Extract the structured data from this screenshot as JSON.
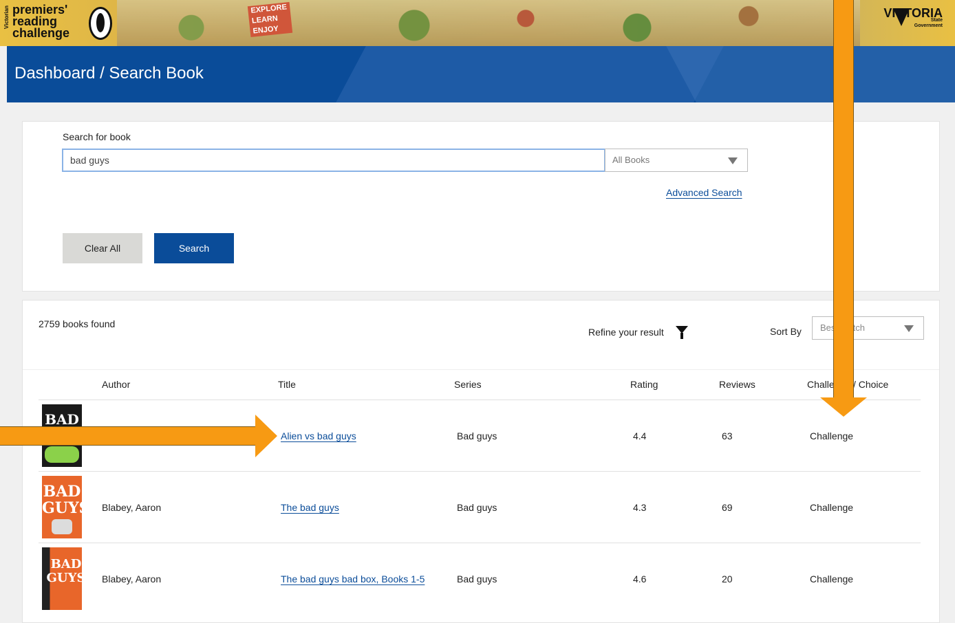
{
  "banner": {
    "logo_lines": [
      "premiers'",
      "reading",
      "challenge"
    ],
    "logo_side": "Victorian",
    "explore_lines": [
      "EXPLORE",
      "LEARN",
      "ENJOY"
    ],
    "victoria": "VICTORIA",
    "victoria_sub": [
      "State",
      "Government"
    ]
  },
  "header": {
    "title": "Dashboard / Search Book"
  },
  "search": {
    "label": "Search for book",
    "query": "bad guys",
    "scope_selected": "All Books",
    "advanced_label": "Advanced Search",
    "clear_label": "Clear All",
    "search_label": "Search"
  },
  "results": {
    "count_text": "2759 books found",
    "refine_label": "Refine your result",
    "sort_label": "Sort By",
    "sort_selected": "Best Match",
    "columns": [
      "Author",
      "Title",
      "Series",
      "Rating",
      "Reviews",
      "Challenge / Choice"
    ],
    "rows": [
      {
        "author": "",
        "title": "Alien vs bad guys",
        "series": "Bad guys",
        "rating": "4.4",
        "reviews": "63",
        "type": "Challenge",
        "cover_color": "#1a1a1a"
      },
      {
        "author": "Blabey, Aaron",
        "title": "The bad guys",
        "series": "Bad guys",
        "rating": "4.3",
        "reviews": "69",
        "type": "Challenge",
        "cover_color": "#e8662a"
      },
      {
        "author": "Blabey, Aaron",
        "title": "The bad guys bad box, Books 1-5",
        "series": "Bad guys",
        "rating": "4.6",
        "reviews": "20",
        "type": "Challenge",
        "cover_color": "#e8662a"
      }
    ]
  },
  "colors": {
    "primary": "#0a4c99",
    "annotation": "#f79a13",
    "banner": "#e9c043"
  }
}
